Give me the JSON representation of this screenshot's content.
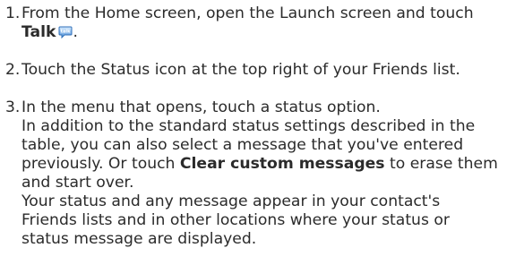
{
  "steps": [
    {
      "number": "1.",
      "line1": "From the Home screen, open the Launch screen and touch",
      "talk_label": "Talk",
      "talk_icon": "talk-app-icon",
      "after_icon": "."
    },
    {
      "number": "2.",
      "line1": "Touch the Status icon at the top right of your Friends list."
    },
    {
      "number": "3.",
      "line1": "In the menu that opens, touch a status option.",
      "line2": "In addition to the standard status settings described in the",
      "line3": "table, you can also select a message that you've entered",
      "line4_pre": "previously. Or touch ",
      "clear_label": "Clear custom messages",
      "line4_post": " to erase them",
      "line5": "and start over.",
      "line6": "Your status and any message appear in your contact's",
      "line7": "Friends lists and in other locations where your status or",
      "line8": "status message are displayed."
    }
  ]
}
